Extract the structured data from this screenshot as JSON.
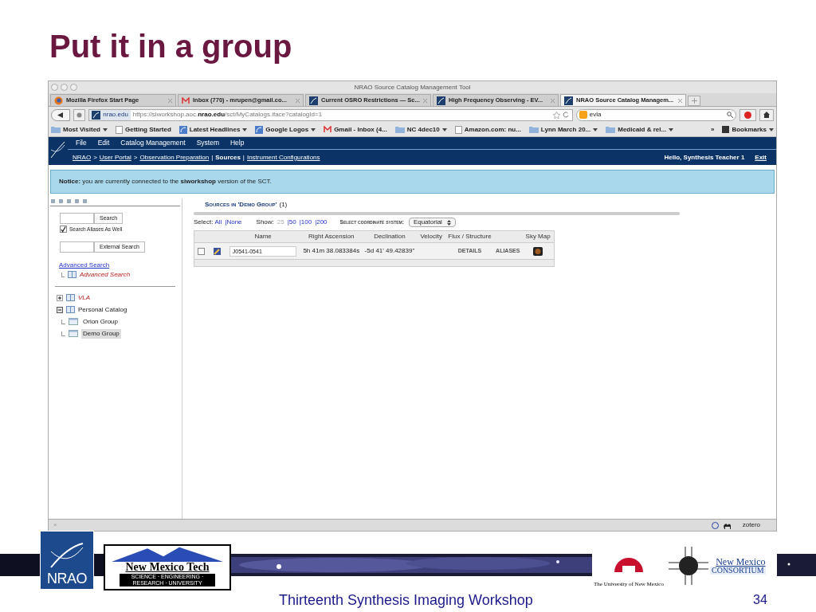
{
  "slide": {
    "title": "Put it in a group",
    "footer": "Thirteenth Synthesis Imaging Workshop",
    "page": "34"
  },
  "logos": {
    "nrao": "NRAO",
    "nmt_name": "New Mexico Tech",
    "nmt_tagline": "SCIENCE · ENGINEERING · RESEARCH · UNIVERSITY",
    "unm": "The University of New Mexico",
    "nmc_1": "New Mexico",
    "nmc_2": "CONSORTIUM"
  },
  "window": {
    "title": "NRAO Source Catalog Management Tool"
  },
  "tabs": [
    {
      "label": "Mozilla Firefox Start Page",
      "kind": "firefox",
      "selected": false
    },
    {
      "label": "Inbox (770) - mrupen@gmail.co...",
      "kind": "gmail",
      "selected": false
    },
    {
      "label": "Current OSRO Restrictions — Sc...",
      "kind": "nrao",
      "selected": false
    },
    {
      "label": "High Frequency Observing - EV...",
      "kind": "nrao",
      "selected": false
    },
    {
      "label": "NRAO Source Catalog Managem...",
      "kind": "nrao",
      "selected": true
    }
  ],
  "nav": {
    "domain": "nrao.edu",
    "url_pre": "https://siworkshop.aoc.",
    "url_bold": "nrao.edu",
    "url_post": "/sct/MyCatalogs.iface?catalogId=1",
    "search": "evla"
  },
  "bookmarks": [
    {
      "label": "Most Visited",
      "kind": "folder",
      "menu": true
    },
    {
      "label": "Getting Started",
      "kind": "page",
      "menu": false
    },
    {
      "label": "Latest Headlines",
      "kind": "feed",
      "menu": true
    },
    {
      "label": "Google Logos",
      "kind": "feed",
      "menu": true
    },
    {
      "label": "Gmail - Inbox (4...",
      "kind": "gmail",
      "menu": false
    },
    {
      "label": "NC 4dec10",
      "kind": "folder",
      "menu": true
    },
    {
      "label": "Amazon.com: nu...",
      "kind": "page",
      "menu": false
    },
    {
      "label": "Lynn March 20...",
      "kind": "folder",
      "menu": true
    },
    {
      "label": "Medicaid & rel...",
      "kind": "folder",
      "menu": true
    }
  ],
  "bookmarks_overflow": "»",
  "bookmarks_menu": "Bookmarks",
  "app": {
    "menu": [
      "File",
      "Edit",
      "Catalog Management",
      "System",
      "Help"
    ],
    "breadcrumbs": [
      {
        "text": "NRAO",
        "kind": "link"
      },
      {
        "text": ">",
        "kind": "sep"
      },
      {
        "text": "User Portal",
        "kind": "link"
      },
      {
        "text": ">",
        "kind": "sep"
      },
      {
        "text": "Observation Preparation",
        "kind": "link"
      },
      {
        "text": "|",
        "kind": "sep"
      },
      {
        "text": "Sources",
        "kind": "current"
      },
      {
        "text": "|",
        "kind": "sep"
      },
      {
        "text": "Instrument Configurations",
        "kind": "link"
      }
    ],
    "greeting": "Hello, Synthesis Teacher 1",
    "exit": "Exit"
  },
  "notice": "**Notice:** you are currently connected to the **siworkshop** version of the SCT.",
  "sidebar": {
    "search_button": "Search",
    "aliases": {
      "label": "Search Aliases As Well",
      "checked": true
    },
    "external_button": "External Search",
    "advanced_link": "Advanced Search",
    "advanced_item": "Advanced Search",
    "tree": [
      {
        "label": "VLA",
        "kind": "public",
        "expanded": false,
        "selected": false
      },
      {
        "label": "Personal Catalog",
        "kind": "personal",
        "expanded": true,
        "selected": false,
        "children": [
          {
            "label": "Orion Group",
            "selected": false
          },
          {
            "label": "Demo Group",
            "selected": true
          }
        ]
      }
    ]
  },
  "sources": {
    "heading": "Sources in 'Demo Group'",
    "count": "(1)",
    "select_label": "Select:",
    "select_all": "All",
    "select_none": "|None",
    "show_label": "Show:",
    "page_sizes": [
      {
        "label": "25",
        "selected": true
      },
      {
        "label": "|50",
        "selected": false
      },
      {
        "label": "|100",
        "selected": false
      },
      {
        "label": "|200",
        "selected": false
      }
    ],
    "coord_label": "Select coordinate system:",
    "coord_value": "Equatorial",
    "columns": [
      "Name",
      "Right Ascension",
      "Declination",
      "Velocity",
      "Flux / Structure",
      "Sky Map"
    ],
    "rows": [
      {
        "checked": false,
        "name": "J0541-0541",
        "ra": "5h 41m 38.083384s",
        "dec": "-5d 41' 49.42839\"",
        "details": "DETAILS",
        "aliases": "ALIASES"
      }
    ]
  },
  "status_bar": {
    "close": "×",
    "zotero": "zotero"
  }
}
